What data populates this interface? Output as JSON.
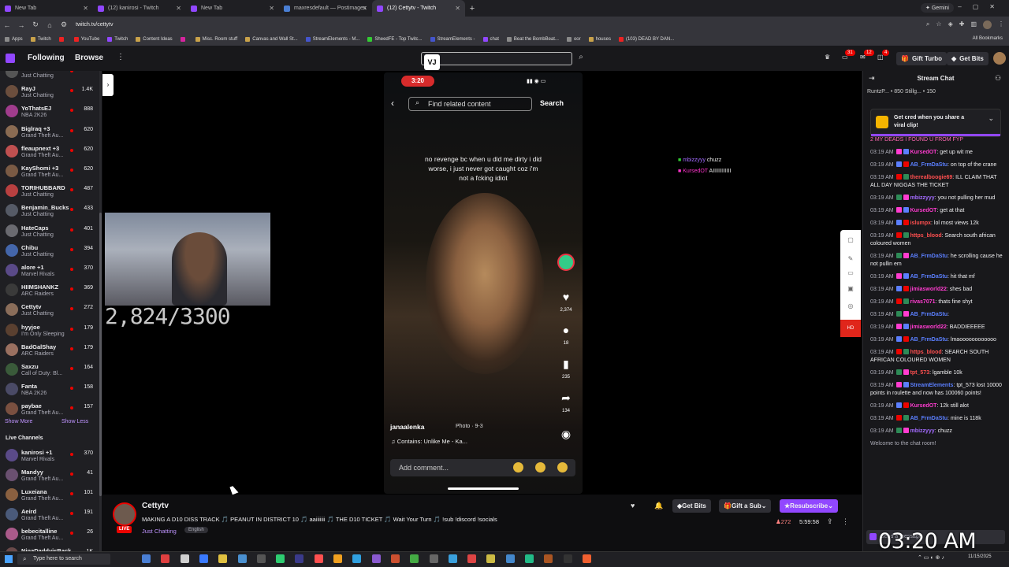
{
  "browser": {
    "tabs": [
      {
        "label": "New Tab",
        "active": false
      },
      {
        "label": "(12) kanirosi - Twitch",
        "active": false
      },
      {
        "label": "New Tab",
        "active": false
      },
      {
        "label": "maxresdefault — Postimages",
        "active": false
      },
      {
        "label": "(12) Cettytv - Twitch",
        "active": true
      }
    ],
    "new_tab": "+",
    "gemini": "Gemini",
    "url": "twitch.tv/cettytv",
    "bookmarks": [
      "Apps",
      "Twitch",
      "",
      "YouTube",
      "Twitch",
      "Content Ideas",
      "",
      "Misc. Room stuff",
      "Canvas and Wall St...",
      "StreamElements - M...",
      "SheedFE - Top Twitc...",
      "StreamElements -",
      "chat",
      "Beat the BombBeat...",
      "oor",
      "houses",
      "(103) DEAD BY DAN..."
    ],
    "all_bookmarks": "All Bookmarks"
  },
  "topnav": {
    "following": "Following",
    "browse": "Browse",
    "search_value": "",
    "notif_count_1": "31",
    "notif_count_2": "12",
    "notif_count_3": "4",
    "gift_turbo": "Gift Turbo",
    "get_bits": "Get Bits"
  },
  "sidebar": {
    "channels": [
      {
        "name": "",
        "game": "Just Chatting",
        "viewers": ""
      },
      {
        "name": "RayJ",
        "game": "Just Chatting",
        "viewers": "1.4K"
      },
      {
        "name": "YoThatsEJ",
        "game": "NBA 2K26",
        "viewers": "888"
      },
      {
        "name": "Biglraq +3",
        "game": "Grand Theft Au...",
        "viewers": "620"
      },
      {
        "name": "fleaupnext +3",
        "game": "Grand Theft Au...",
        "viewers": "620"
      },
      {
        "name": "KayShomi +3",
        "game": "Grand Theft Au...",
        "viewers": "620"
      },
      {
        "name": "TORIHUBBARD",
        "game": "Just Chatting",
        "viewers": "487"
      },
      {
        "name": "Benjamin_Bucks",
        "game": "Just Chatting",
        "viewers": "433"
      },
      {
        "name": "HateCaps",
        "game": "Just Chatting",
        "viewers": "401"
      },
      {
        "name": "Chibu",
        "game": "Just Chatting",
        "viewers": "394"
      },
      {
        "name": "alore +1",
        "game": "Marvel Rivals",
        "viewers": "370"
      },
      {
        "name": "HIIMSHANKZ",
        "game": "ARC Raiders",
        "viewers": "369"
      },
      {
        "name": "Cettytv",
        "game": "Just Chatting",
        "viewers": "272"
      },
      {
        "name": "hyyjoe",
        "game": "I'm Only Sleeping",
        "viewers": "179"
      },
      {
        "name": "BadGalShay",
        "game": "ARC Raiders",
        "viewers": "179"
      },
      {
        "name": "Saxzu",
        "game": "Call of Duty: Bl...",
        "viewers": "164"
      },
      {
        "name": "Fanta",
        "game": "NBA 2K26",
        "viewers": "158"
      },
      {
        "name": "paybae",
        "game": "Grand Theft Au...",
        "viewers": "157"
      }
    ],
    "show_more": "Show More",
    "show_less": "Show Less",
    "live_header": "Live Channels",
    "live_channels": [
      {
        "name": "kanirosi +1",
        "game": "Marvel Rivals",
        "viewers": "370"
      },
      {
        "name": "Mandyy",
        "game": "Grand Theft Au...",
        "viewers": "41"
      },
      {
        "name": "Luxeiana",
        "game": "Grand Theft Au...",
        "viewers": "101"
      },
      {
        "name": "Aeird",
        "game": "Grand Theft Au...",
        "viewers": "191"
      },
      {
        "name": "bebecitalline",
        "game": "Grand Theft Au...",
        "viewers": "26"
      },
      {
        "name": "NinaDaddyisBack",
        "game": "",
        "viewers": "1K"
      }
    ]
  },
  "player": {
    "goal_text": "2,824/3300",
    "phone": {
      "time": "3:20",
      "find_placeholder": "Find related content",
      "search": "Search",
      "caption": "no revenge bc when u did me dirty i did worse, i just never got caught coz i'm not a fcking idiot",
      "likes": "2,374",
      "comments": "18",
      "saves": "235",
      "shares": "134",
      "username": "janaalenka",
      "photo_label": "Photo · 9-3",
      "music": "Contains: Unlike Me - Ka...",
      "comment_placeholder": "Add comment..."
    },
    "overlay_chat": [
      {
        "user": "mbizzyyy",
        "text": "chuzz"
      },
      {
        "user": "KursedOT",
        "text": "AIIIIIIIIIIII"
      }
    ]
  },
  "info": {
    "streamer": "Cettytv",
    "live": "LIVE",
    "title": "MAKING A D10 DISS TRACK 🎵 PEANUT IN DISTRICT 10 🎵 aaiiiiiii 🎵 THE D10 TICKET 🎵 Wait Your Turn 🎵 !sub !discord !socials",
    "category": "Just Chatting",
    "language": "English",
    "get_bits": "Get Bits",
    "gift_sub": "Gift a Sub",
    "resubscribe": "Resubscribe",
    "viewers": "272",
    "uptime": "5:59:58"
  },
  "chat": {
    "header": "Stream Chat",
    "leaderboard": "RuntzP... • 850   Stillg... • 150",
    "promo": "Get cred when you share a viral clip!",
    "messages": [
      {
        "time": "",
        "user": "",
        "color": "#ff69b4",
        "text": "2 MY DEADS I FOUND U FROM FYP"
      },
      {
        "time": "03:19 AM",
        "user": "KursedOT",
        "color": "#ff3cd0",
        "text": ": get up wit me"
      },
      {
        "time": "03:19 AM",
        "user": "AB_FrmDaStu",
        "color": "#5b7fff",
        "text": ": on top of the crane"
      },
      {
        "time": "03:19 AM",
        "user": "therealboogie69",
        "color": "#ff4f4f",
        "text": ": ILL CLAIM THAT ALL DAY NIGGAS THE TICKET"
      },
      {
        "time": "03:19 AM",
        "user": "mbizzyyy",
        "color": "#a36bff",
        "text": ": you not pulling her mud"
      },
      {
        "time": "03:19 AM",
        "user": "KursedOT",
        "color": "#ff3cd0",
        "text": ": get at that"
      },
      {
        "time": "03:19 AM",
        "user": "islumpx",
        "color": "#ff4f4f",
        "text": ": lol most views 12k"
      },
      {
        "time": "03:19 AM",
        "user": "https_blood",
        "color": "#ff4f4f",
        "text": ": Search south african coloured women"
      },
      {
        "time": "03:19 AM",
        "user": "AB_FrmDaStu",
        "color": "#5b7fff",
        "text": ": he scrolling cause he not pullin em"
      },
      {
        "time": "03:19 AM",
        "user": "AB_FrmDaStu",
        "color": "#5b7fff",
        "text": ": hit that mf"
      },
      {
        "time": "03:19 AM",
        "user": "jimiasworld22",
        "color": "#ff3cd0",
        "text": ": shes bad"
      },
      {
        "time": "03:19 AM",
        "user": "rivas7071",
        "color": "#ff3cd0",
        "text": ": thats fine shyt"
      },
      {
        "time": "03:19 AM",
        "user": "AB_FrmDaStu",
        "color": "#5b7fff",
        "text": ":"
      },
      {
        "time": "03:19 AM",
        "user": "jimiasworld22",
        "color": "#ff3cd0",
        "text": ": BADDIEEEEE"
      },
      {
        "time": "03:19 AM",
        "user": "AB_FrmDaStu",
        "color": "#5b7fff",
        "text": ": lmaoooooooooooo"
      },
      {
        "time": "03:19 AM",
        "user": "https_blood",
        "color": "#ff4f4f",
        "text": ": SEARCH SOUTH AFRICAN COLOURED WOMEN"
      },
      {
        "time": "03:19 AM",
        "user": "tpt_573",
        "color": "#ff4f4f",
        "text": ": lgamble 10k"
      },
      {
        "time": "03:19 AM",
        "user": "StreamElements",
        "color": "#5b7fff",
        "text": ": tpt_573 lost 10000 points in roulette and now has 100060 points!"
      },
      {
        "time": "03:19 AM",
        "user": "KursedOT",
        "color": "#ff3cd0",
        "text": ": 12k still alot"
      },
      {
        "time": "03:19 AM",
        "user": "AB_FrmDaStu",
        "color": "#5b7fff",
        "text": ": mine is 118k"
      },
      {
        "time": "03:19 AM",
        "user": "mbizzyyy",
        "color": "#a36bff",
        "text": ": chuzz"
      }
    ],
    "welcome": "Welcome to the chat room!",
    "input_placeholder": "Send a message"
  },
  "overlay_clock": "03:20 AM",
  "taskbar": {
    "search_placeholder": "Type here to search",
    "date": "11/15/2025"
  },
  "colors": {
    "twitch_purple": "#9147ff",
    "live_red": "#eb0400",
    "bg": "#0e0e10"
  }
}
